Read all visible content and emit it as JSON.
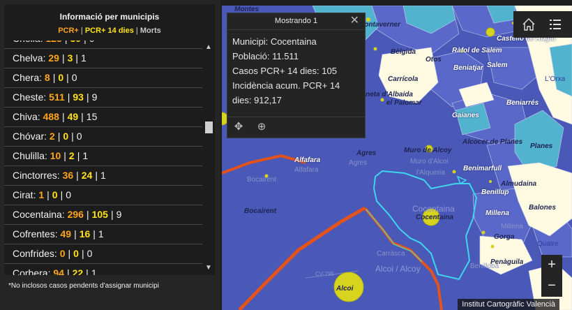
{
  "panel": {
    "title": "Informació per municipis",
    "legend": {
      "pcr": "PCR+",
      "pcr14": "PCR+ 14 dies",
      "morts": "Morts",
      "sep": "|"
    },
    "rows": [
      {
        "name": "Chella",
        "pcr": "125",
        "pcr14": "30",
        "morts": "0"
      },
      {
        "name": "Chelva",
        "pcr": "29",
        "pcr14": "3",
        "morts": "1"
      },
      {
        "name": "Chera",
        "pcr": "8",
        "pcr14": "0",
        "morts": "0"
      },
      {
        "name": "Cheste",
        "pcr": "511",
        "pcr14": "93",
        "morts": "9"
      },
      {
        "name": "Chiva",
        "pcr": "488",
        "pcr14": "49",
        "morts": "15"
      },
      {
        "name": "Chóvar",
        "pcr": "2",
        "pcr14": "0",
        "morts": "0"
      },
      {
        "name": "Chulilla",
        "pcr": "10",
        "pcr14": "2",
        "morts": "1"
      },
      {
        "name": "Cinctorres",
        "pcr": "36",
        "pcr14": "24",
        "morts": "1"
      },
      {
        "name": "Cirat",
        "pcr": "1",
        "pcr14": "0",
        "morts": "0"
      },
      {
        "name": "Cocentaina",
        "pcr": "296",
        "pcr14": "105",
        "morts": "9"
      },
      {
        "name": "Cofrentes",
        "pcr": "49",
        "pcr14": "16",
        "morts": "1"
      },
      {
        "name": "Confrides",
        "pcr": "0",
        "pcr14": "0",
        "morts": "0"
      },
      {
        "name": "Corbera",
        "pcr": "94",
        "pcr14": "22",
        "morts": "1"
      }
    ],
    "scroll_up": "▲",
    "scroll_down": "▼",
    "footnote": "*No inclosos casos pendents d'assignar municipi"
  },
  "popup": {
    "title": "Mostrando 1",
    "close": "✕",
    "lines": {
      "municipi": "Municipi: Cocentaina",
      "poblacio": "Població: 11.511",
      "casos": "Casos PCR+ 14 dies: 105",
      "incidencia": "Incidència acum. PCR+ 14 dies: 912,17"
    },
    "tools": {
      "pan": "✥",
      "zoom": "⊕"
    }
  },
  "map": {
    "towns": {
      "montaverner": "Montaverner",
      "castello": "Castelló de Rugat",
      "belgida": "Bèlgida",
      "otos": "Otos",
      "rafol": "Ràfol de Salem",
      "beniatjar": "Beniatjar",
      "salem": "Salem",
      "orxa": "L'Orxa",
      "carricola": "Carrícola",
      "olleria": "neta d'Albaida",
      "palomar": "el Palomar",
      "beniarres": "Beniarrés",
      "gaianes": "Gaianes",
      "alcocer": "Alcocer de Planes",
      "planes": "Planes",
      "agres": "Agres",
      "agres2": "Agres",
      "muro": "Muro de Alcoy",
      "muro2": "Muro d'Alcoi",
      "alfafara": "Alfafara",
      "alfafara2": "Alfafara",
      "alqueria": "l'Alqueria",
      "benimarfull": "Benimarfull",
      "almudaina": "Almudaina",
      "benillup": "Benillup",
      "bocairent": "Bocairent",
      "bocairent2": "Bocairent",
      "cocentaina": "Cocentaina",
      "cocentaina2": "Cocentaina",
      "balones": "Balones",
      "millena": "Millena",
      "millena2": "Millena",
      "gorga": "Gorga",
      "quatretondeta": "Quatre",
      "carrasca": "Carràsca",
      "alcoi": "Alcoi / Alcoy",
      "penaguila": "Penàguila",
      "benilloba": "Benilloba",
      "alcoi2": "Alcoi",
      "cv795": "CV-795",
      "montes": "Montes"
    },
    "zoom_in": "+",
    "zoom_out": "−",
    "attribution": "Institut Cartogràfic Valencià",
    "colors": {
      "base": "#4a58b8",
      "mid": "#5f6fcd",
      "light": "#52b3cf",
      "pale": "#fffbe3",
      "road": "#e2541c",
      "boundary": "#3ed6ef"
    }
  }
}
